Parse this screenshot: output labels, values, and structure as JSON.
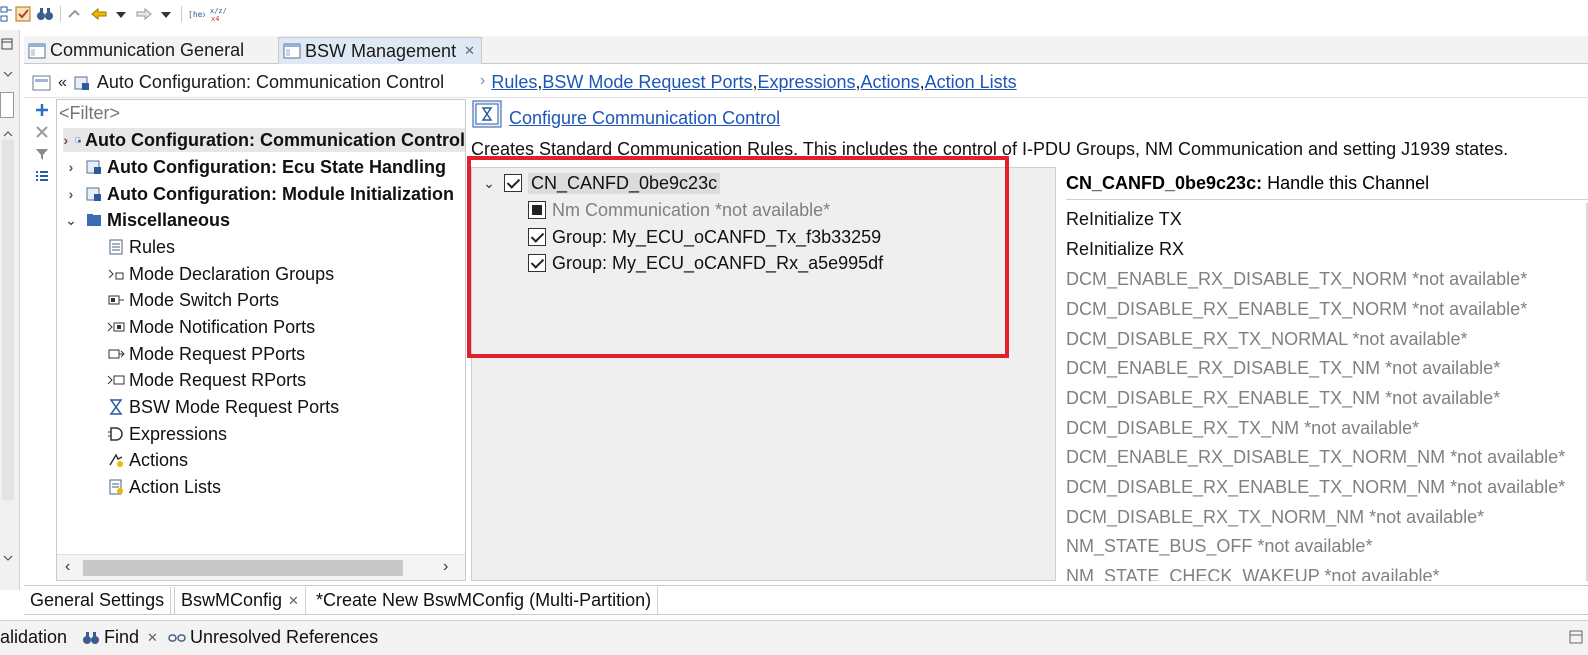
{
  "toolbar": {
    "icons": [
      "tree-icon",
      "config-icon",
      "binoculars-icon",
      "link-icon",
      "back-arrow-icon",
      "dropdown-icon",
      "forward-arrow-icon",
      "dropdown-icon",
      "hex-icon",
      "compare-icon"
    ]
  },
  "editor_tabs": [
    {
      "label": "Communication General",
      "active": false
    },
    {
      "label": "BSW Management",
      "active": true
    }
  ],
  "breadcrumb": {
    "current": "Auto Configuration: Communication Control",
    "links": [
      "Rules",
      "BSW Mode Request Ports",
      "Expressions",
      "Actions",
      "Action Lists"
    ],
    "separator": ", "
  },
  "tree": {
    "filter_placeholder": "<Filter>",
    "items": [
      {
        "label": "Auto Configuration: Communication Control",
        "bold": true,
        "expander": "›",
        "selected": true
      },
      {
        "label": "Auto Configuration: Ecu State Handling",
        "bold": true,
        "expander": "›"
      },
      {
        "label": "Auto Configuration: Module Initialization",
        "bold": true,
        "expander": "›"
      },
      {
        "label": "Miscellaneous",
        "bold": true,
        "expander": "⌄"
      },
      {
        "label": "Rules",
        "bold": false
      },
      {
        "label": "Mode Declaration Groups",
        "bold": false
      },
      {
        "label": "Mode Switch Ports",
        "bold": false
      },
      {
        "label": "Mode Notification Ports",
        "bold": false
      },
      {
        "label": "Mode Request PPorts",
        "bold": false
      },
      {
        "label": "Mode Request RPorts",
        "bold": false
      },
      {
        "label": "BSW Mode Request Ports",
        "bold": false
      },
      {
        "label": "Expressions",
        "bold": false
      },
      {
        "label": "Actions",
        "bold": false
      },
      {
        "label": "Action Lists",
        "bold": false
      }
    ]
  },
  "content": {
    "title": "Configure Communication Control",
    "description": "Creates Standard Communication Rules. This includes the control of I-PDU Groups, NM Communication and setting J1939 states."
  },
  "channel_tree": [
    {
      "label": "CN_CANFD_0be9c23c",
      "state": "checked"
    },
    {
      "label": "Nm Communication *not available*",
      "state": "partial"
    },
    {
      "label": "Group: My_ECU_oCANFD_Tx_f3b33259",
      "state": "checked"
    },
    {
      "label": "Group: My_ECU_oCANFD_Rx_a5e995df",
      "state": "checked"
    }
  ],
  "properties": {
    "channel_name": "CN_CANFD_0be9c23c:",
    "heading_suffix": " Handle this Channel",
    "items": [
      {
        "label": "ReInitialize TX",
        "available": true
      },
      {
        "label": "ReInitialize RX",
        "available": true
      },
      {
        "label": "DCM_ENABLE_RX_DISABLE_TX_NORM *not available*",
        "available": false
      },
      {
        "label": "DCM_DISABLE_RX_ENABLE_TX_NORM *not available*",
        "available": false
      },
      {
        "label": "DCM_DISABLE_RX_TX_NORMAL *not available*",
        "available": false
      },
      {
        "label": "DCM_ENABLE_RX_DISABLE_TX_NM *not available*",
        "available": false
      },
      {
        "label": "DCM_DISABLE_RX_ENABLE_TX_NM *not available*",
        "available": false
      },
      {
        "label": "DCM_DISABLE_RX_TX_NM *not available*",
        "available": false
      },
      {
        "label": "DCM_ENABLE_RX_DISABLE_TX_NORM_NM *not available*",
        "available": false
      },
      {
        "label": "DCM_DISABLE_RX_ENABLE_TX_NORM_NM *not available*",
        "available": false
      },
      {
        "label": "DCM_DISABLE_RX_TX_NORM_NM *not available*",
        "available": false
      },
      {
        "label": "NM_STATE_BUS_OFF *not available*",
        "available": false
      },
      {
        "label": "NM_STATE_CHECK_WAKEUP *not available*",
        "available": false
      }
    ]
  },
  "page_tabs": [
    {
      "label": "General Settings",
      "closable": false
    },
    {
      "label": "BswMConfig",
      "closable": true
    },
    {
      "label": "*Create New BswMConfig (Multi-Partition)",
      "closable": false
    }
  ],
  "view_tabs": [
    {
      "label": "alidation",
      "closable": false
    },
    {
      "label": "Find",
      "closable": true
    },
    {
      "label": "Unresolved References",
      "closable": false
    }
  ],
  "colors": {
    "highlight": "#e0202a",
    "link": "#1d56b8",
    "dim_text": "#808080"
  }
}
